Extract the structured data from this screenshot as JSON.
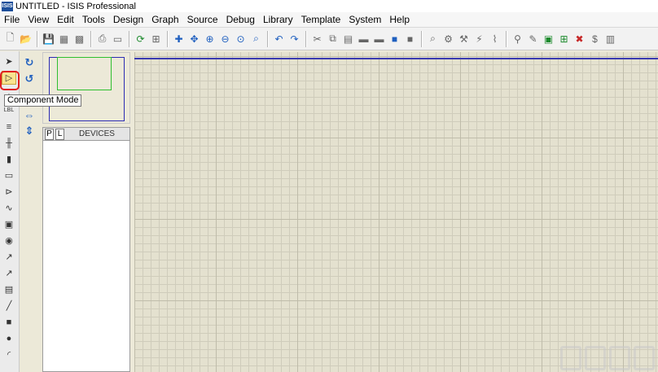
{
  "window": {
    "icon_text": "ISIS",
    "title": "UNTITLED - ISIS Professional"
  },
  "menu": {
    "items": [
      "File",
      "View",
      "Edit",
      "Tools",
      "Design",
      "Graph",
      "Source",
      "Debug",
      "Library",
      "Template",
      "System",
      "Help"
    ]
  },
  "toolbar": {
    "buttons": [
      {
        "icon": "new-file-icon",
        "glyph": "🗋"
      },
      {
        "icon": "open-folder-icon",
        "glyph": "📂"
      },
      {
        "icon": "save-icon",
        "glyph": "💾"
      },
      {
        "icon": "import-icon",
        "glyph": "▦"
      },
      {
        "icon": "export-icon",
        "glyph": "▩"
      },
      {
        "icon": "print-icon",
        "glyph": "⎙"
      },
      {
        "icon": "print-area-icon",
        "glyph": "▭"
      },
      {
        "icon": "refresh-icon",
        "glyph": "⟳"
      },
      {
        "icon": "grid-icon",
        "glyph": "⊞"
      },
      {
        "icon": "origin-icon",
        "glyph": "✚"
      },
      {
        "icon": "pan-icon",
        "glyph": "✥"
      },
      {
        "icon": "zoom-in-icon",
        "glyph": "⊕"
      },
      {
        "icon": "zoom-out-icon",
        "glyph": "⊖"
      },
      {
        "icon": "zoom-all-icon",
        "glyph": "⊙"
      },
      {
        "icon": "zoom-area-icon",
        "glyph": "⌕"
      },
      {
        "icon": "undo-icon",
        "glyph": "↶"
      },
      {
        "icon": "redo-icon",
        "glyph": "↷"
      },
      {
        "icon": "cut-icon",
        "glyph": "✂"
      },
      {
        "icon": "copy-icon",
        "glyph": "⧉"
      },
      {
        "icon": "paste-icon",
        "glyph": "▤"
      },
      {
        "icon": "block-copy-icon",
        "glyph": "▬"
      },
      {
        "icon": "block-move-icon",
        "glyph": "▬"
      },
      {
        "icon": "block-rotate-icon",
        "glyph": "■"
      },
      {
        "icon": "block-delete-icon",
        "glyph": "■"
      },
      {
        "icon": "pick-device-icon",
        "glyph": "⌕"
      },
      {
        "icon": "make-device-icon",
        "glyph": "⚙"
      },
      {
        "icon": "package-tool-icon",
        "glyph": "⚒"
      },
      {
        "icon": "decompose-icon",
        "glyph": "⚡"
      },
      {
        "icon": "wire-autorouter-icon",
        "glyph": "⌇"
      },
      {
        "icon": "search-tag-icon",
        "glyph": "⚲"
      },
      {
        "icon": "property-assign-icon",
        "glyph": "✎"
      },
      {
        "icon": "new-sheet-icon",
        "glyph": "▣"
      },
      {
        "icon": "add-sheet-icon",
        "glyph": "⊞"
      },
      {
        "icon": "delete-sheet-icon",
        "glyph": "✖"
      },
      {
        "icon": "bill-of-materials-icon",
        "glyph": "$"
      },
      {
        "icon": "netlist-icon",
        "glyph": "▥"
      }
    ],
    "separators_after": [
      1,
      4,
      6,
      8,
      14,
      16,
      23,
      28
    ]
  },
  "left_tools": {
    "buttons": [
      {
        "icon": "selection-mode-icon",
        "glyph": "➤",
        "active": false
      },
      {
        "icon": "component-mode-icon",
        "glyph": "▷",
        "active": true
      },
      {
        "icon": "junction-dot-icon",
        "glyph": "·"
      },
      {
        "icon": "wire-label-icon",
        "glyph": "LBL"
      },
      {
        "icon": "text-script-icon",
        "glyph": "≡"
      },
      {
        "icon": "buses-icon",
        "glyph": "╫"
      },
      {
        "icon": "subcircuit-icon",
        "glyph": "▮"
      },
      {
        "icon": "terminals-icon",
        "glyph": "▭"
      },
      {
        "icon": "device-pins-icon",
        "glyph": "⊳"
      },
      {
        "icon": "graph-mode-icon",
        "glyph": "∿"
      },
      {
        "icon": "tape-recorder-icon",
        "glyph": "▣"
      },
      {
        "icon": "generator-icon",
        "glyph": "◉"
      },
      {
        "icon": "voltage-probe-icon",
        "glyph": "↗"
      },
      {
        "icon": "current-probe-icon",
        "glyph": "↗"
      },
      {
        "icon": "virtual-instruments-icon",
        "glyph": "▤"
      },
      {
        "icon": "line-tool-icon",
        "glyph": "╱"
      },
      {
        "icon": "box-tool-icon",
        "glyph": "■"
      },
      {
        "icon": "circle-tool-icon",
        "glyph": "●"
      },
      {
        "icon": "arc-tool-icon",
        "glyph": "◜"
      }
    ]
  },
  "rotate_tools": {
    "buttons": [
      {
        "icon": "rotate-clockwise-icon",
        "glyph": "↻"
      },
      {
        "icon": "rotate-anticlockwise-icon",
        "glyph": "↺"
      },
      {
        "icon": "mirror-horizontal-icon",
        "glyph": "⇔"
      },
      {
        "icon": "mirror-vertical-icon",
        "glyph": "⇕"
      }
    ]
  },
  "tooltip": {
    "text": "Component Mode"
  },
  "devices": {
    "tab_p": "P",
    "tab_l": "L",
    "label": "DEVICES"
  },
  "colors": {
    "canvas_bg": "#e4e1cf",
    "grid_major": "#bfbcaa",
    "sheet_border": "#3a3ab0",
    "highlight": "#e02020"
  }
}
